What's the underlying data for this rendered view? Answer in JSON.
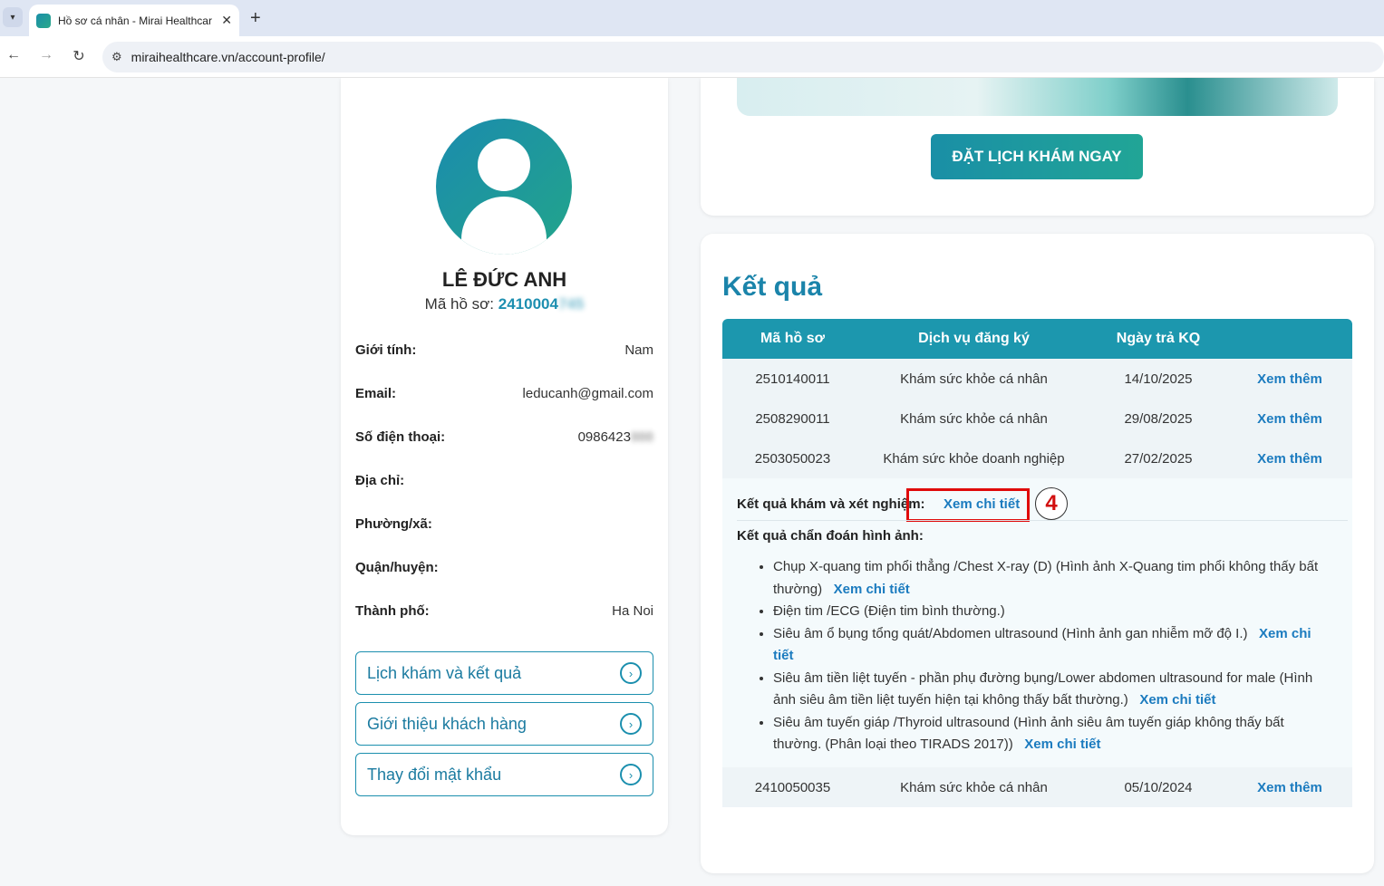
{
  "browser": {
    "tab_title": "Hồ sơ cá nhân - Mirai Healthcare",
    "url": "miraihealthcare.vn/account-profile/"
  },
  "profile": {
    "name": "LÊ ĐỨC ANH",
    "code_label": "Mã hồ sơ:",
    "code_visible": "2410004",
    "code_hidden": "745",
    "fields": [
      {
        "label": "Giới tính:",
        "value": "Nam"
      },
      {
        "label": "Email:",
        "value": "leducanh@gmail.com"
      },
      {
        "label": "Số điện thoại:",
        "value": "0986423",
        "value_hidden": "888"
      },
      {
        "label": "Địa chỉ:",
        "value": ""
      },
      {
        "label": "Phường/xã:",
        "value": ""
      },
      {
        "label": "Quận/huyện:",
        "value": ""
      },
      {
        "label": "Thành phố:",
        "value": "Ha Noi"
      }
    ],
    "menu": [
      {
        "label": "Lịch khám và kết quả"
      },
      {
        "label": "Giới thiệu khách hàng"
      },
      {
        "label": "Thay đổi mật khẩu"
      }
    ]
  },
  "booking": {
    "button_label": "ĐẶT LỊCH KHÁM NGAY"
  },
  "results": {
    "title": "Kết quả",
    "columns": [
      "Mã hồ sơ",
      "Dịch vụ đăng ký",
      "Ngày trả KQ"
    ],
    "rows": [
      {
        "code": "2510140011",
        "service": "Khám sức khỏe cá nhân",
        "date": "14/10/2025",
        "action": "Xem thêm"
      },
      {
        "code": "2508290011",
        "service": "Khám sức khỏe cá nhân",
        "date": "29/08/2025",
        "action": "Xem thêm"
      },
      {
        "code": "2503050023",
        "service": "Khám sức khỏe doanh nghiệp",
        "date": "27/02/2025",
        "action": "Xem thêm"
      },
      {
        "code": "2410050035",
        "service": "Khám sức khỏe cá nhân",
        "date": "05/10/2024",
        "action": "Xem thêm"
      }
    ],
    "detail": {
      "lab_label": "Kết quả khám và xét nghiệm:",
      "lab_link": "Xem chi tiết",
      "step_number": "4",
      "imaging_label": "Kết quả chẩn đoán hình ảnh:",
      "imaging_items": [
        {
          "text": "Chụp X-quang tim phổi thẳng /Chest X-ray (D) (Hình ảnh X-Quang tim phổi không thấy bất thường)",
          "link": "Xem chi tiết"
        },
        {
          "text": "Điện tim /ECG (Điện tim bình thường.)",
          "link": ""
        },
        {
          "text": "Siêu âm ổ bụng tổng quát/Abdomen ultrasound (Hình ảnh gan nhiễm mỡ độ I.)",
          "link": "Xem chi tiết"
        },
        {
          "text": "Siêu âm tiền liệt tuyến - phần phụ đường bụng/Lower abdomen ultrasound for male (Hình ảnh siêu âm tiền liệt tuyến hiện tại không thấy bất thường.)",
          "link": "Xem chi tiết"
        },
        {
          "text": "Siêu âm tuyến giáp /Thyroid ultrasound (Hình ảnh siêu âm tuyến giáp không thấy bất thường. (Phân loại theo TIRADS 2017))",
          "link": "Xem chi tiết"
        }
      ]
    }
  }
}
